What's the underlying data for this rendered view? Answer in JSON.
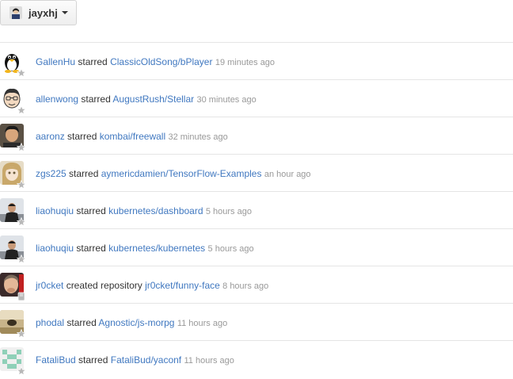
{
  "account_switcher": {
    "username": "jayxhj",
    "icon": "chevron-down-icon"
  },
  "feed": [
    {
      "actor": "GallenHu",
      "action": "starred",
      "repo": "ClassicOldSong/bPlayer",
      "time": "19 minutes ago",
      "icon": "star-icon"
    },
    {
      "actor": "allenwong",
      "action": "starred",
      "repo": "AugustRush/Stellar",
      "time": "30 minutes ago",
      "icon": "star-icon"
    },
    {
      "actor": "aaronz",
      "action": "starred",
      "repo": "kombai/freewall",
      "time": "32 minutes ago",
      "icon": "star-icon"
    },
    {
      "actor": "zgs225",
      "action": "starred",
      "repo": "aymericdamien/TensorFlow-Examples",
      "time": "an hour ago",
      "icon": "star-icon"
    },
    {
      "actor": "liaohuqiu",
      "action": "starred",
      "repo": "kubernetes/dashboard",
      "time": "5 hours ago",
      "icon": "star-icon"
    },
    {
      "actor": "liaohuqiu",
      "action": "starred",
      "repo": "kubernetes/kubernetes",
      "time": "5 hours ago",
      "icon": "star-icon"
    },
    {
      "actor": "jr0cket",
      "action": "created repository",
      "repo": "jr0cket/funny-face",
      "time": "8 hours ago",
      "icon": "repo-icon"
    },
    {
      "actor": "phodal",
      "action": "starred",
      "repo": "Agnostic/js-morpg",
      "time": "11 hours ago",
      "icon": "star-icon"
    },
    {
      "actor": "FataliBud",
      "action": "starred",
      "repo": "FataliBud/yaconf",
      "time": "11 hours ago",
      "icon": "star-icon"
    }
  ],
  "colors": {
    "link": "#4078c0",
    "time": "#999999",
    "text": "#333333",
    "divider": "#e5e5e5"
  }
}
